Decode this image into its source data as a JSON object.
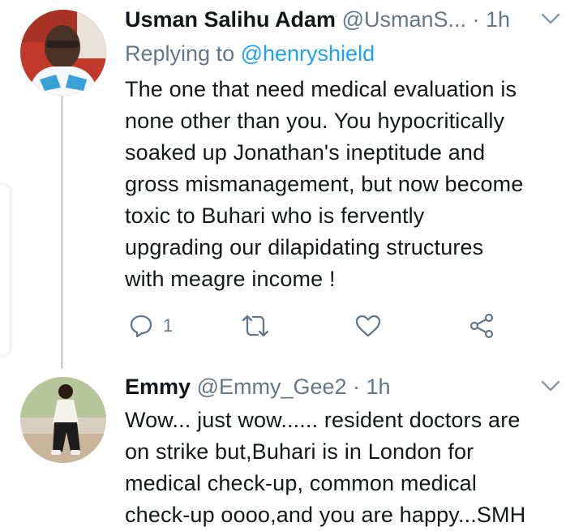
{
  "tweets": [
    {
      "name": "Usman Salihu Adam",
      "handle": "@UsmanS...",
      "time": "· 1h",
      "reply_prefix": "Replying to ",
      "reply_to": "@henryshield",
      "text": "The one that need medical evaluation is\nnone other than you. You hypocritically\nsoaked up Jonathan's ineptitude and\ngross mismanagement, but now become\ntoxic to Buhari who is fervently\nupgrading our dilapidating structures\nwith meagre income !",
      "actions": {
        "reply_count": "1",
        "retweet_count": "",
        "like_count": ""
      }
    },
    {
      "name": "Emmy",
      "handle": "@Emmy_Gee2",
      "time": "· 1h",
      "text": "Wow... just wow...... resident doctors are\non strike but,Buhari is in London for\nmedical check-up, common medical\ncheck-up oooo,and you are happy...SMH"
    }
  ],
  "icons": {
    "reply": "reply-icon",
    "retweet": "retweet-icon",
    "like": "heart-icon",
    "share": "share-icon",
    "more": "chevron-down-icon"
  },
  "colors": {
    "text": "#14171a",
    "muted": "#657786",
    "link": "#1da1f2",
    "thread_line": "#cdd6dd"
  }
}
